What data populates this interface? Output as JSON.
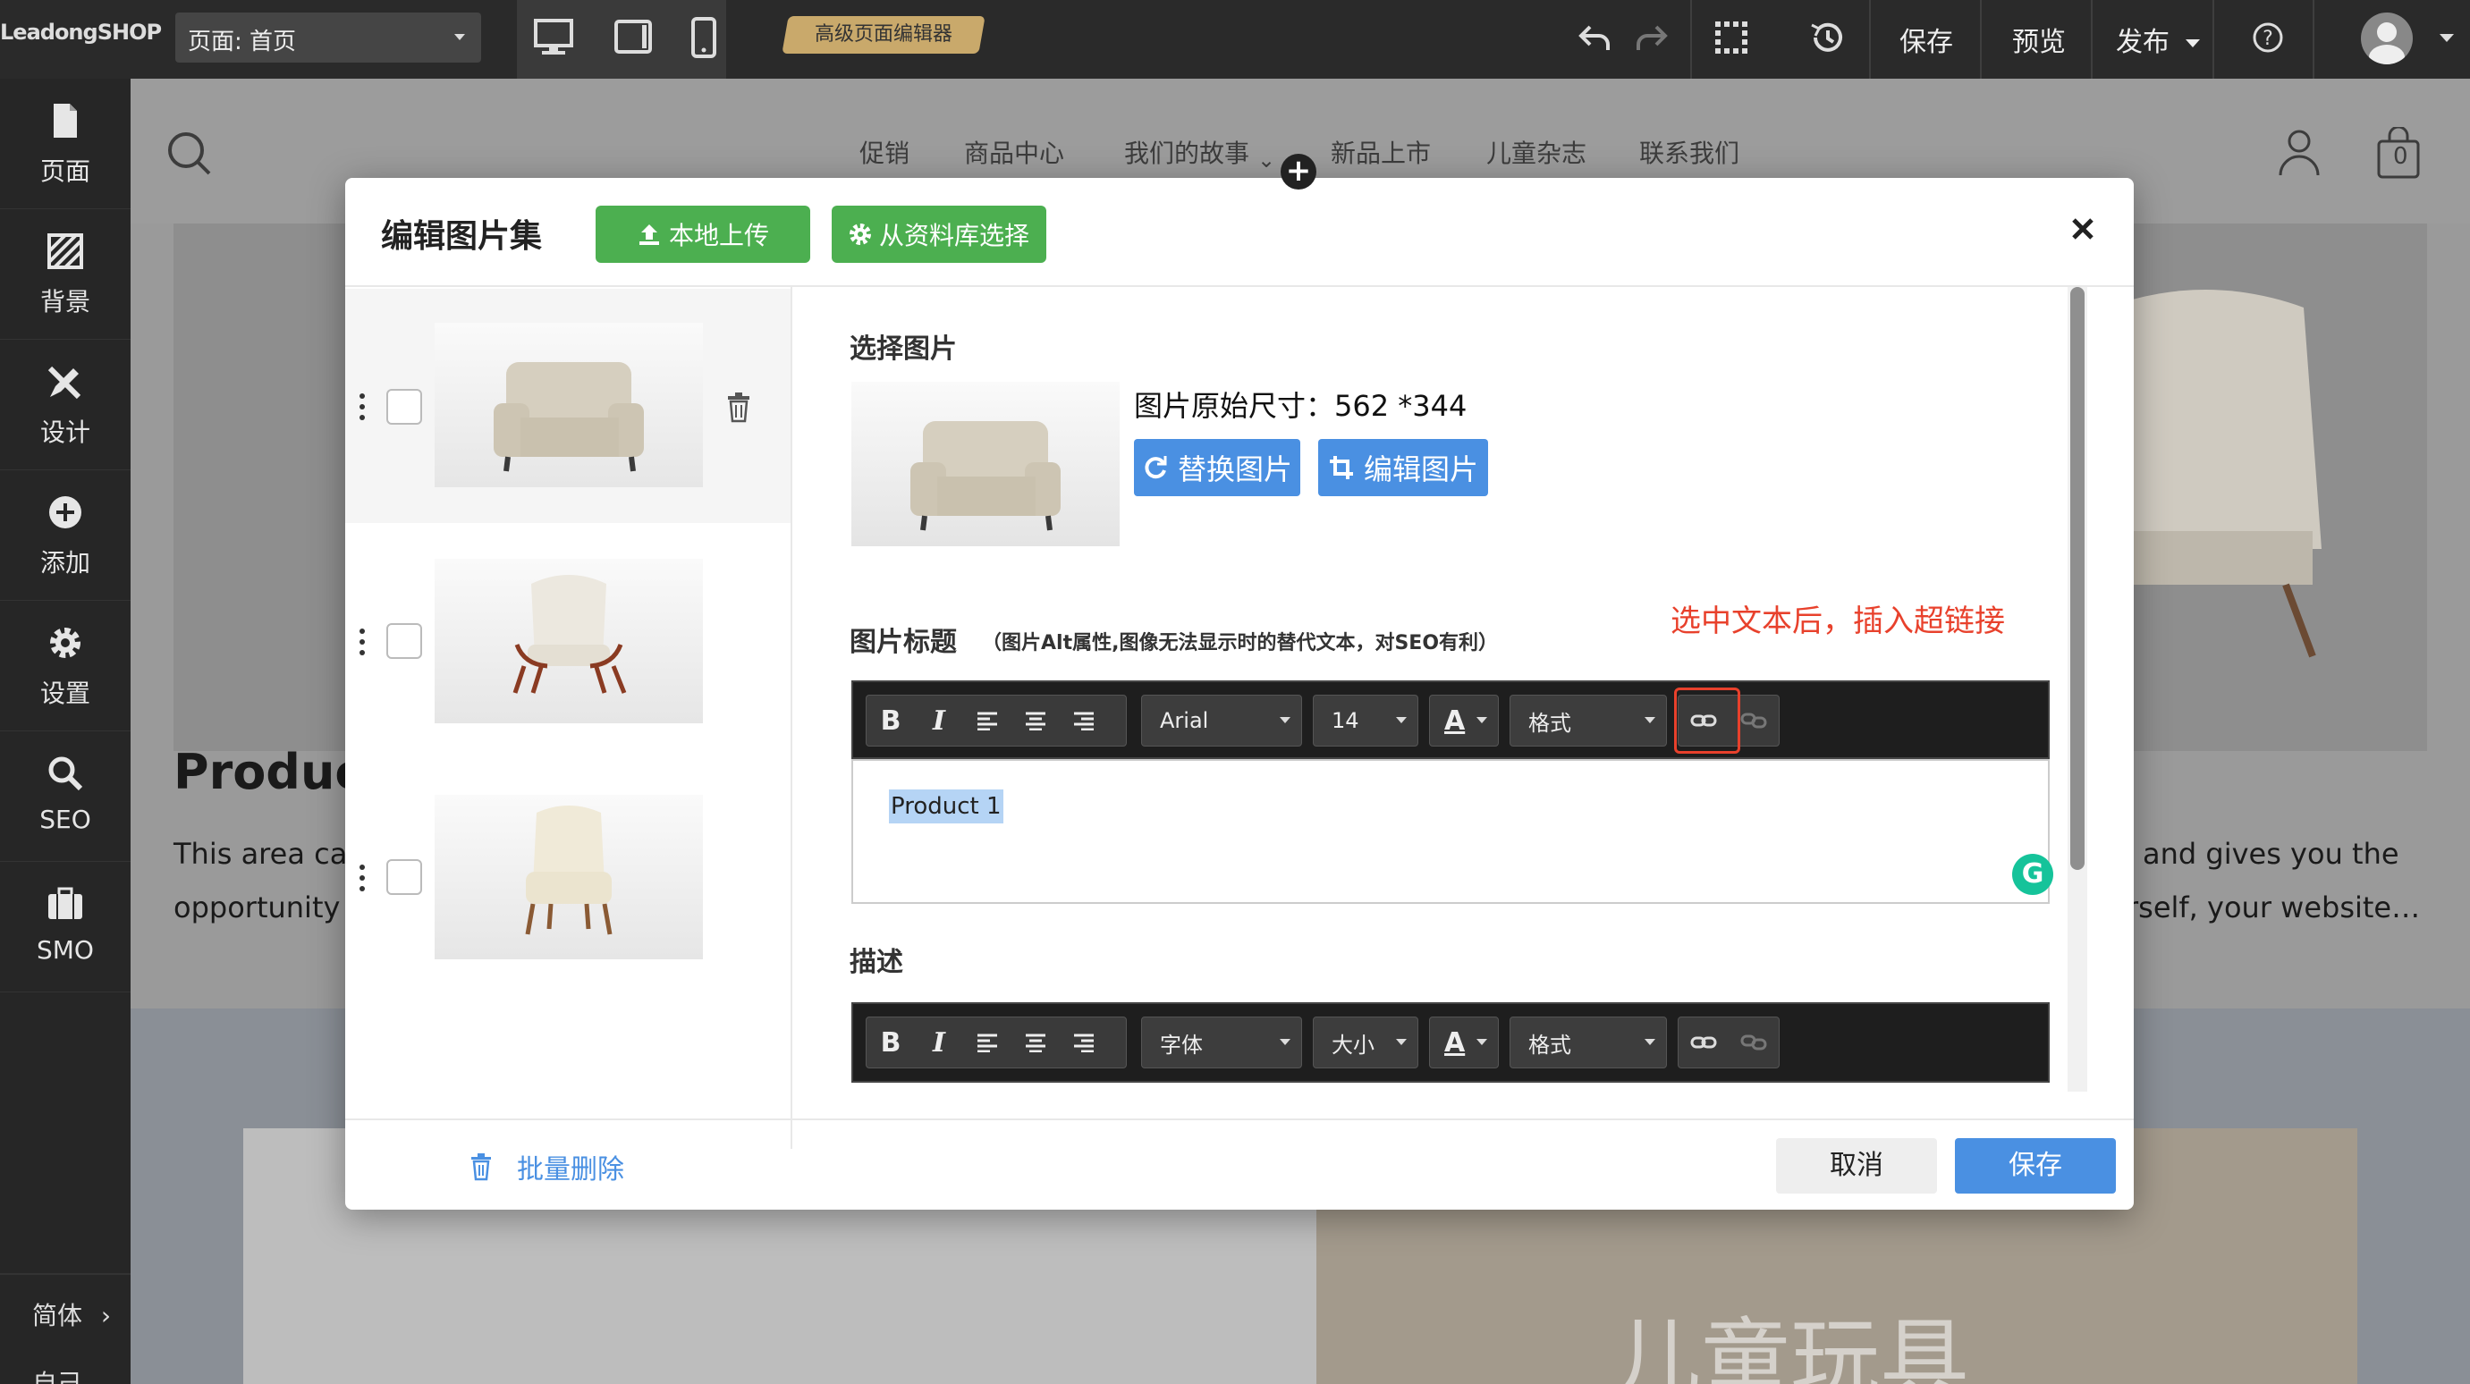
{
  "topbar": {
    "logo": "LeadongSHOP",
    "page_select": "页面: 首页",
    "advanced_editor": "高级页面编辑器",
    "save": "保存",
    "preview": "预览",
    "publish": "发布"
  },
  "sidebar": {
    "items": [
      {
        "label": "页面",
        "icon": "page-icon"
      },
      {
        "label": "背景",
        "icon": "background-icon"
      },
      {
        "label": "设计",
        "icon": "design-icon"
      },
      {
        "label": "添加",
        "icon": "add-icon"
      },
      {
        "label": "设置",
        "icon": "gear-icon"
      },
      {
        "label": "SEO",
        "icon": "search-icon"
      },
      {
        "label": "SMO",
        "icon": "briefcase-icon"
      }
    ],
    "language": "简体",
    "bottom_cut": "自己"
  },
  "site": {
    "nav": [
      "促销",
      "商品中心",
      "我们的故事",
      "新品上市",
      "儿童杂志",
      "联系我们"
    ],
    "cart_count": "0",
    "heading": "Produc",
    "text_left_1": "This area ca",
    "text_left_2": "opportunity t",
    "text_right_1": "and gives you the",
    "text_right_2": "rself, your website…",
    "banner_text": "儿童玩具"
  },
  "modal": {
    "title": "编辑图片集",
    "upload_btn": "本地上传",
    "library_btn": "从资料库选择",
    "select_image_label": "选择图片",
    "original_size": "图片原始尺寸：562 *344",
    "replace_btn": "替换图片",
    "edit_btn": "编辑图片",
    "caption_label": "图片标题",
    "caption_hint": "（图片Alt属性,图像无法显示时的替代文本，对SEO有利）",
    "annotation": "选中文本后，插入超链接",
    "caption_toolbar": {
      "font": "Arial",
      "size": "14",
      "format": "格式"
    },
    "caption_text": "Product 1",
    "desc_label": "描述",
    "desc_toolbar": {
      "font": "字体",
      "size": "大小",
      "format": "格式"
    },
    "batch_delete": "批量删除",
    "cancel": "取消",
    "save": "保存"
  },
  "colors": {
    "green": "#4caf50",
    "blue": "#4a90e2",
    "annotation_red": "#e8412c"
  }
}
